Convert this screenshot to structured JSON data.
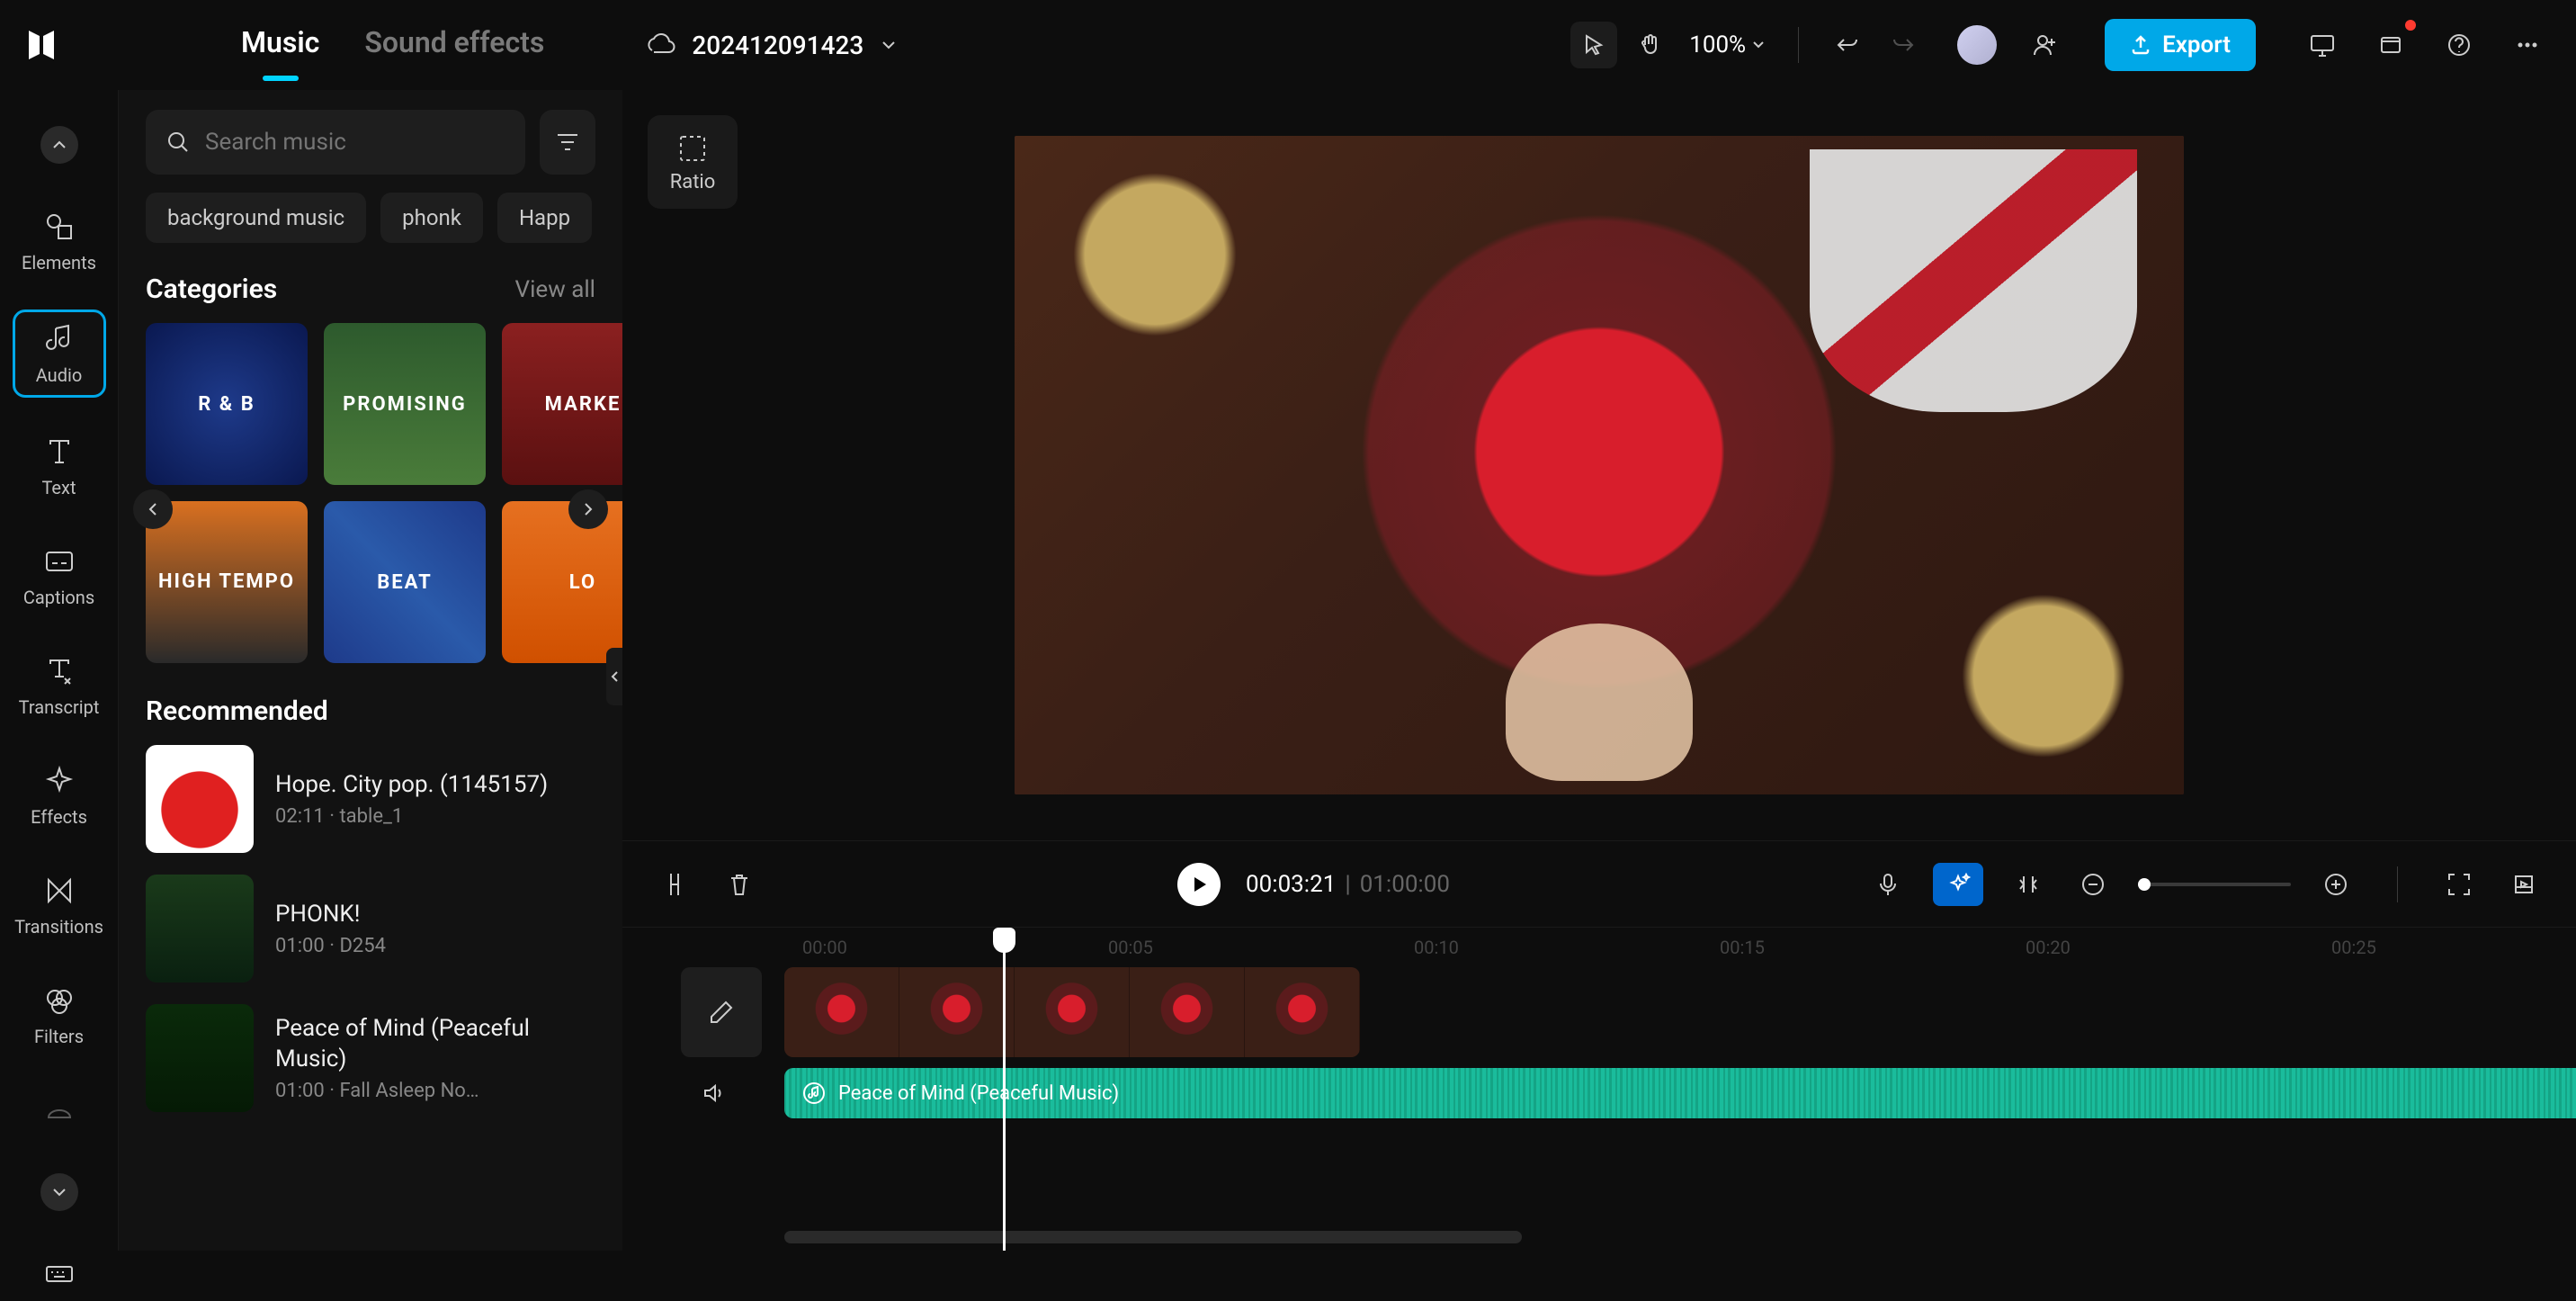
{
  "header": {
    "tabs": {
      "music": "Music",
      "sfx": "Sound effects"
    },
    "project_name": "202412091423",
    "zoom": "100%",
    "export_label": "Export"
  },
  "rail": {
    "elements": "Elements",
    "audio": "Audio",
    "text": "Text",
    "captions": "Captions",
    "transcript": "Transcript",
    "effects": "Effects",
    "transitions": "Transitions",
    "filters": "Filters"
  },
  "search": {
    "placeholder": "Search music"
  },
  "chips": [
    "background music",
    "phonk",
    "Happ"
  ],
  "categories": {
    "title": "Categories",
    "view_all": "View all",
    "tiles": [
      "R & B",
      "PROMISING",
      "MARKE",
      "HIGH TEMPO",
      "BEAT",
      "LO"
    ]
  },
  "recommended": {
    "title": "Recommended",
    "items": [
      {
        "title": "Hope. City pop. (1145157)",
        "meta": "02:11 · table_1"
      },
      {
        "title": "PHONK!",
        "meta": "01:00 · D254"
      },
      {
        "title": "Peace of Mind (Peaceful Music)",
        "meta": "01:00 · Fall Asleep No…"
      }
    ]
  },
  "ratio": {
    "label": "Ratio"
  },
  "player": {
    "current": "00:03:21",
    "total": "01:00:00"
  },
  "ruler_marks": [
    {
      "pos": 200,
      "label": "00:00"
    },
    {
      "pos": 540,
      "label": "00:05"
    },
    {
      "pos": 880,
      "label": "00:10"
    },
    {
      "pos": 1220,
      "label": "00:15"
    },
    {
      "pos": 1560,
      "label": "00:20"
    },
    {
      "pos": 1900,
      "label": "00:25"
    }
  ],
  "timeline": {
    "audio_clip_label": "Peace of Mind (Peaceful Music)"
  }
}
